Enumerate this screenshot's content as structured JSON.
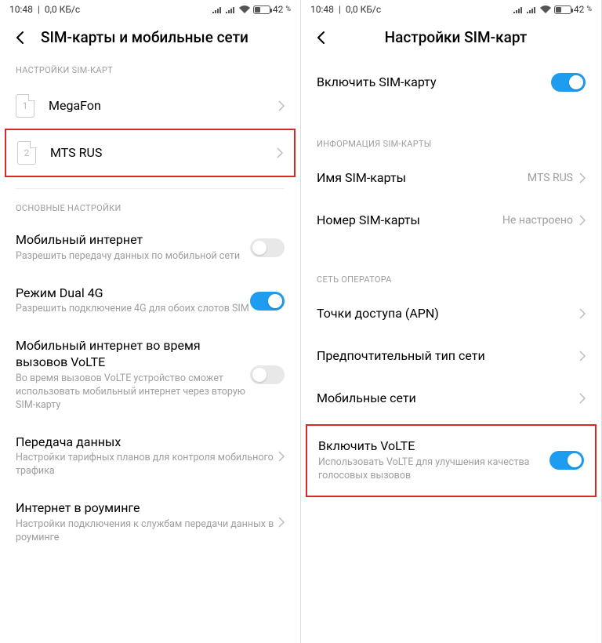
{
  "status": {
    "time": "10:48",
    "speed": "0,0 КБ/с",
    "battery": "42"
  },
  "screen1": {
    "title": "SIM-карты и мобильные сети",
    "sections": {
      "sim_settings": "НАСТРОЙКИ SIM-КАРТ",
      "main_settings": "ОСНОВНЫЕ НАСТРОЙКИ"
    },
    "sim1": {
      "num": "1",
      "name": "MegaFon"
    },
    "sim2": {
      "num": "2",
      "name": "MTS RUS"
    },
    "mobile_internet": {
      "label": "Мобильный интернет",
      "sub": "Разрешить передачу данных по мобильной сети"
    },
    "dual4g": {
      "label": "Режим Dual 4G",
      "sub": "Разрешить подключение 4G для обоих слотов SIM"
    },
    "volte_call": {
      "label": "Мобильный интернет во время вызовов VoLTE",
      "sub": "Во время вызовов VoLTE устройство сможет использовать мобильный интернет через вторую SIM-карту"
    },
    "data_transfer": {
      "label": "Передача данных",
      "sub": "Настройки тарифных планов для контроля мобильного трафика"
    },
    "roaming": {
      "label": "Интернет в роуминге",
      "sub": "Настройки подключения к службам передачи данных в роуминге"
    }
  },
  "screen2": {
    "title": "Настройки SIM-карт",
    "enable_sim": "Включить SIM-карту",
    "sections": {
      "info": "ИНФОРМАЦИЯ SIM-КАРТЫ",
      "operator": "СЕТЬ ОПЕРАТОРА"
    },
    "sim_name": {
      "label": "Имя SIM-карты",
      "value": "MTS RUS"
    },
    "sim_number": {
      "label": "Номер SIM-карты",
      "value": "Не настроено"
    },
    "apn": "Точки доступа (APN)",
    "net_type": "Предпочтительный тип сети",
    "mobile_nets": "Мобильные сети",
    "volte": {
      "label": "Включить VoLTE",
      "sub": "Использовать VoLTE для улучшения качества голосовых вызовов"
    }
  }
}
